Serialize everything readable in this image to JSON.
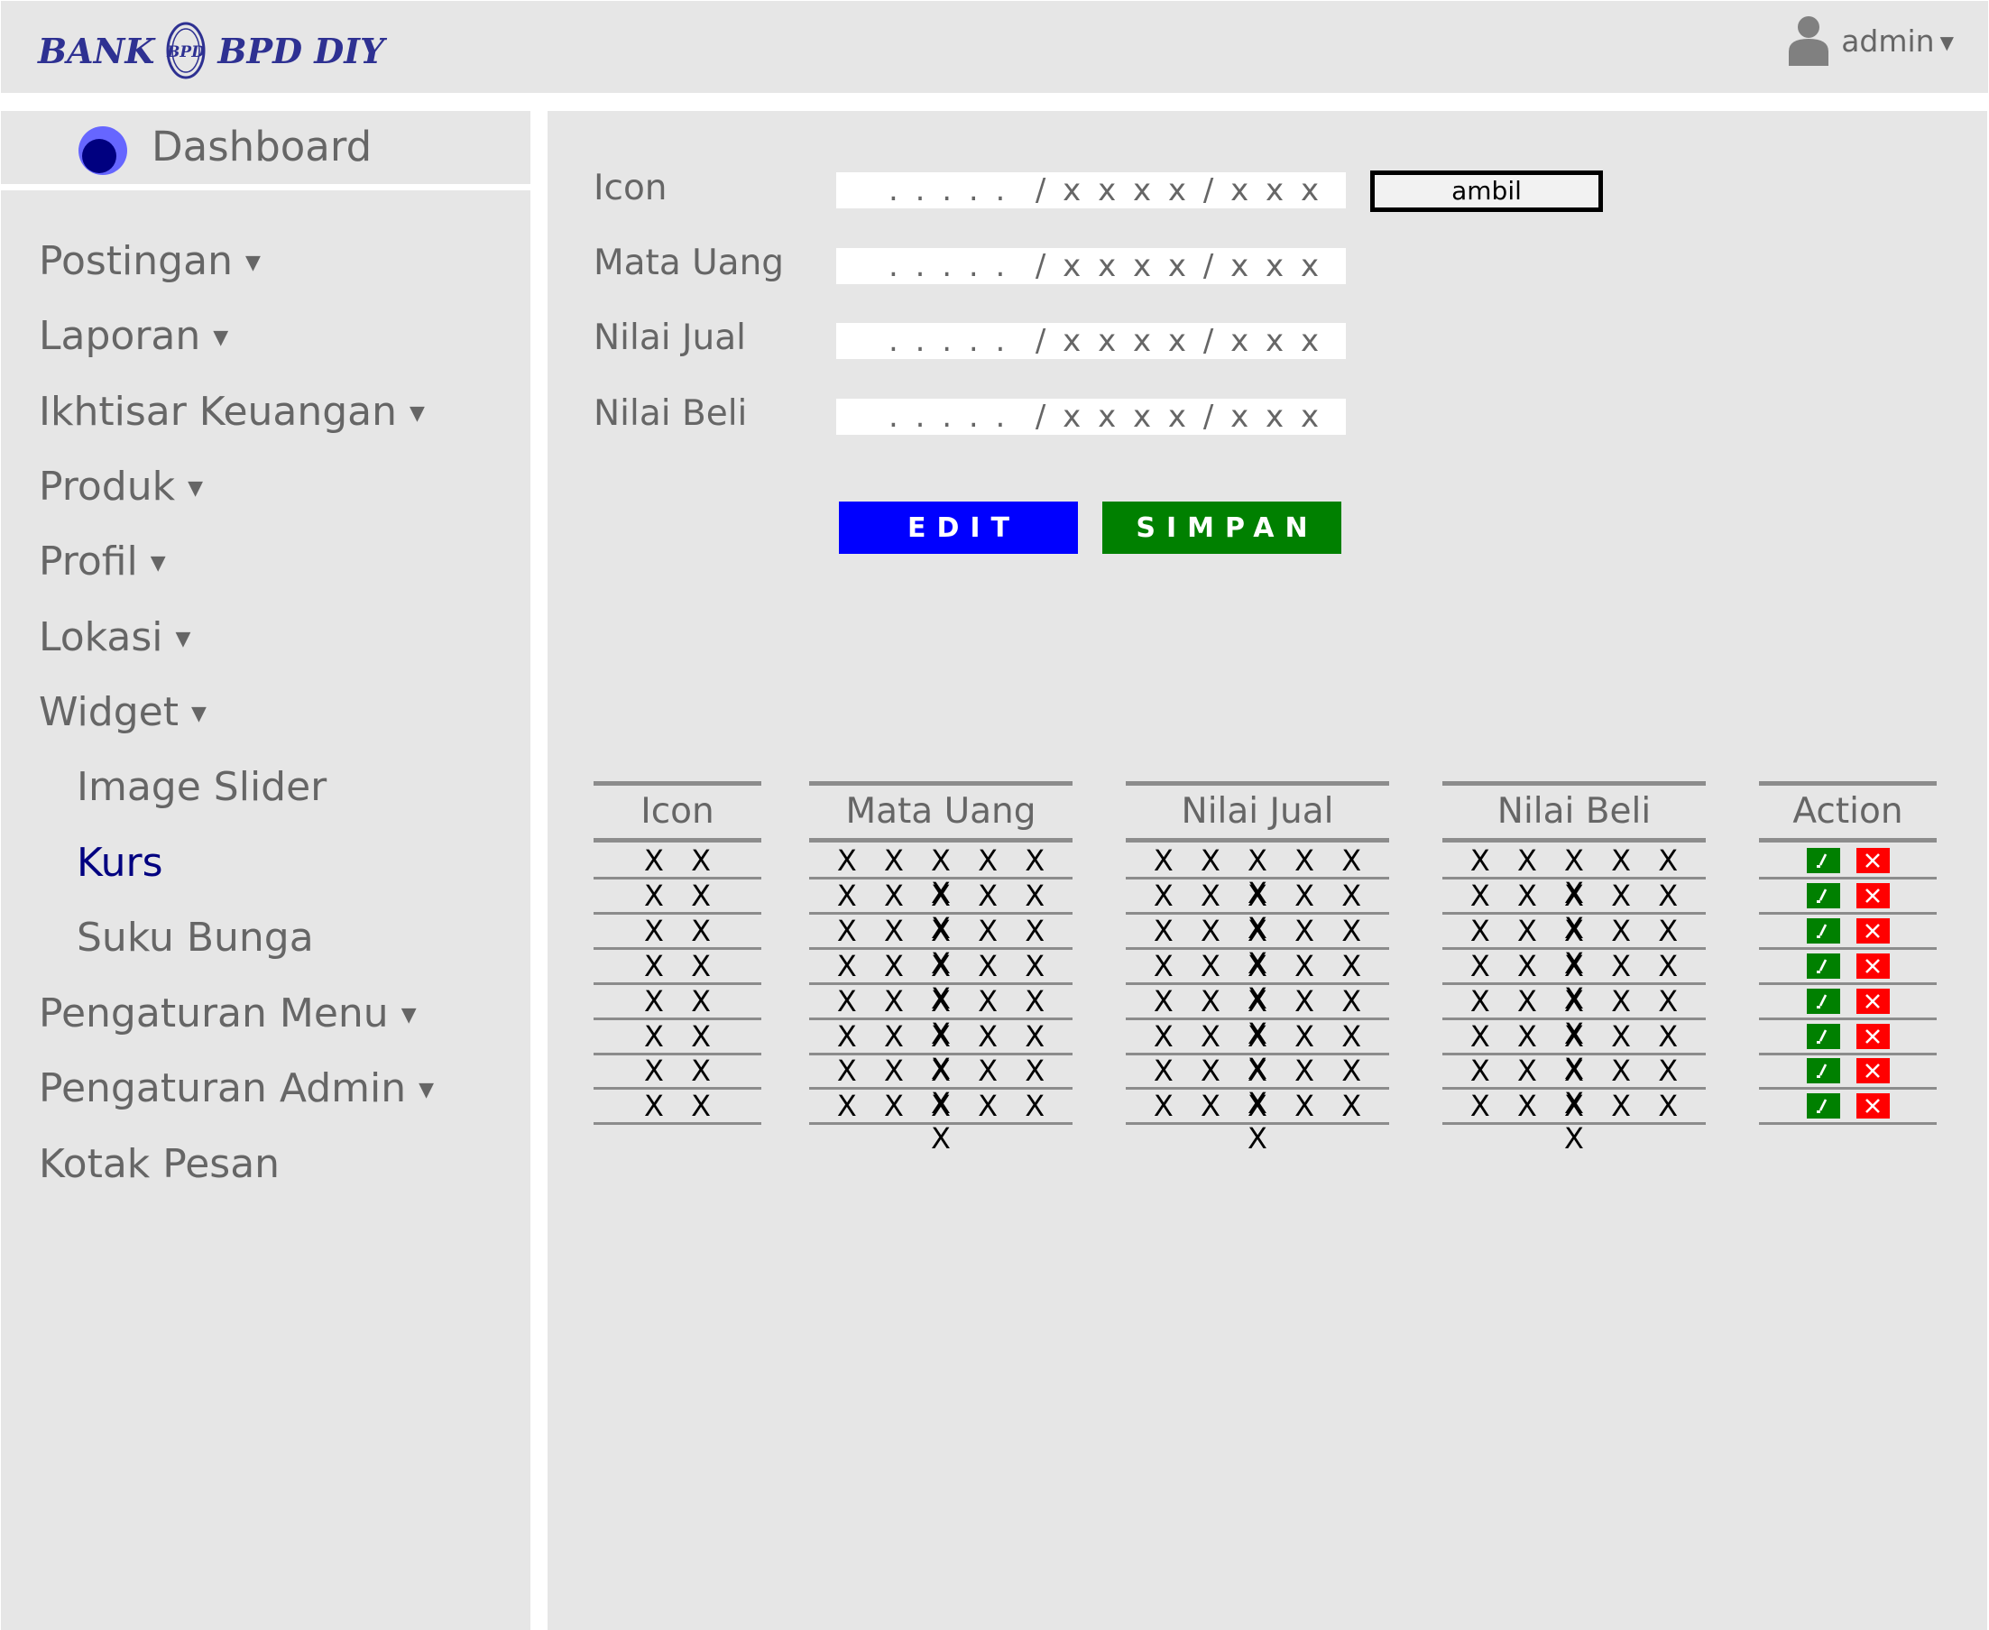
{
  "header": {
    "logo_left": "BANK",
    "logo_right": "BPD DIY",
    "user_name": "admin"
  },
  "sidebar": {
    "dashboard_label": "Dashboard",
    "items": [
      {
        "label": "Postingan",
        "has_caret": true
      },
      {
        "label": "Laporan",
        "has_caret": true
      },
      {
        "label": "Ikhtisar Keuangan",
        "has_caret": true
      },
      {
        "label": "Produk",
        "has_caret": true
      },
      {
        "label": "Profil",
        "has_caret": true
      },
      {
        "label": "Lokasi",
        "has_caret": true
      },
      {
        "label": "Widget",
        "has_caret": true
      },
      {
        "label": "Image Slider",
        "sub": true
      },
      {
        "label": "Kurs",
        "sub": true,
        "active": true
      },
      {
        "label": "Suku Bunga",
        "sub": true
      },
      {
        "label": "Pengaturan Menu",
        "has_caret": true
      },
      {
        "label": "Pengaturan Admin",
        "has_caret": true
      },
      {
        "label": "Kotak Pesan"
      }
    ],
    "caret_glyph": "▼"
  },
  "form": {
    "fields": [
      {
        "label": "Icon",
        "placeholder": ". . . . .  / x x x x / x x x"
      },
      {
        "label": "Mata Uang",
        "placeholder": ". . . . .  / x x x x / x x x"
      },
      {
        "label": "Nilai Jual",
        "placeholder": ". . . . .  / x x x x / x x x"
      },
      {
        "label": "Nilai Beli",
        "placeholder": ". . . . .  / x x x x / x x x"
      }
    ],
    "ambil_label": "ambil",
    "edit_label": "EDIT",
    "simpan_label": "SIMPAN"
  },
  "table": {
    "headers": [
      "Icon",
      "Mata Uang",
      "Nilai Jual",
      "Nilai Beli",
      "Action"
    ],
    "rows": [
      [
        "X X",
        "X X X X X X",
        "X X X X X X",
        "X X X X X X"
      ],
      [
        "X X",
        "X X X X X X",
        "X X X X X X",
        "X X X X X X"
      ],
      [
        "X X",
        "X X X X X X",
        "X X X X X X",
        "X X X X X X"
      ],
      [
        "X X",
        "X X X X X X",
        "X X X X X X",
        "X X X X X X"
      ],
      [
        "X X",
        "X X X X X X",
        "X X X X X X",
        "X X X X X X"
      ],
      [
        "X X",
        "X X X X X X",
        "X X X X X X",
        "X X X X X X"
      ],
      [
        "X X",
        "X X X X X X",
        "X X X X X X",
        "X X X X X X"
      ],
      [
        "X X",
        "X X X X X X",
        "X X X X X X",
        "X X X X X X"
      ]
    ],
    "action_icons": [
      "edit-check-icon",
      "delete-x-icon"
    ]
  },
  "colors": {
    "panel_bg": "#e6e6e6",
    "text_gray": "#666666",
    "active_nav": "#000080",
    "brand": "#2e3192",
    "edit_btn": "#0000ff",
    "simpan_btn": "#008000",
    "ok_icon": "#008000",
    "delete_icon": "#ff0000"
  }
}
